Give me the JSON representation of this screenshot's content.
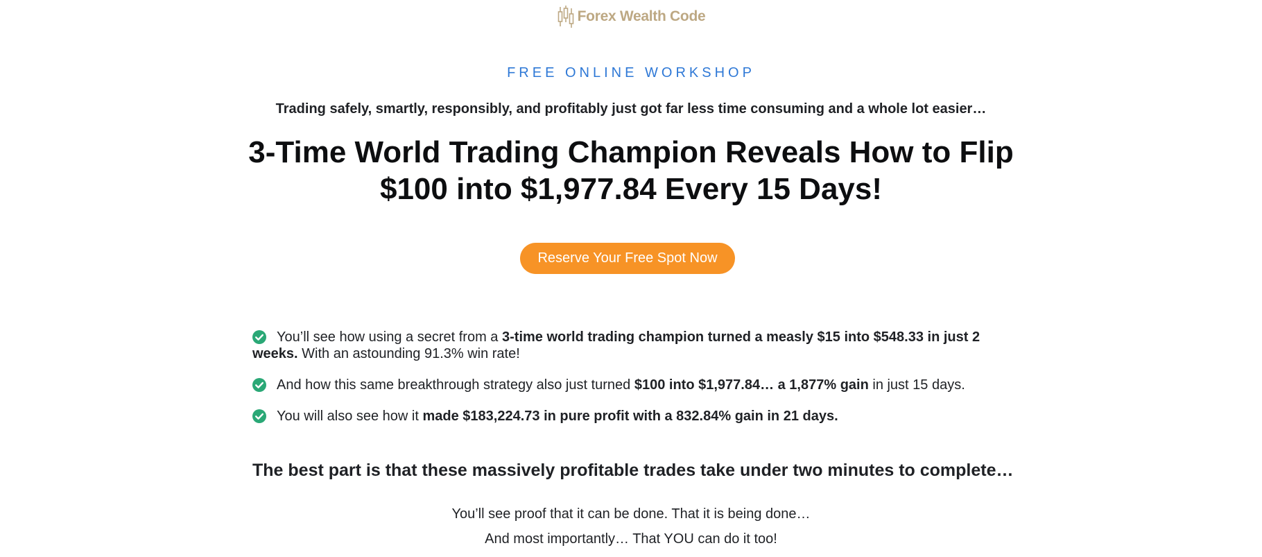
{
  "brand": {
    "name": "Forex Wealth Code",
    "color": "#bda883",
    "icon": "candlestick-logo-icon"
  },
  "kicker": "FREE ONLINE WORKSHOP",
  "subhead": "Trading safely, smartly, responsibly, and profitably just got far less time consuming and a whole lot easier…",
  "headline": {
    "line1": "3-Time World Trading Champion Reveals How to Flip",
    "line2": "$100 into $1,977.84 Every 15 Days!"
  },
  "cta": {
    "label": "Reserve Your Free Spot Now",
    "color": "#f79326"
  },
  "bullets": [
    {
      "icon": "check-circle-icon",
      "pre": "You’ll see how using a secret from a ",
      "bold": "3-time world trading champion turned a measly $15 into $548.33 in just 2 weeks.",
      "post": " With an astounding 91.3% win rate!"
    },
    {
      "icon": "check-circle-icon",
      "pre": "And how this same breakthrough strategy also just turned ",
      "bold": "$100 into $1,977.84… a 1,877% gain",
      "post": "  in just 15 days."
    },
    {
      "icon": "check-circle-icon",
      "pre": "You will also see how it ",
      "bold": "made $183,224.73 in pure profit with a 832.84% gain in 21 days.",
      "post": ""
    }
  ],
  "best_part": "The best part is that these massively profitable trades take under two minutes to complete…",
  "proof": {
    "line1": "You’ll see proof that it can be done. That it is being done…",
    "line2": "And most importantly… That YOU can do it too!"
  },
  "colors": {
    "accent": "#2e78d6",
    "check": "#2aa876",
    "cta": "#f79326"
  }
}
